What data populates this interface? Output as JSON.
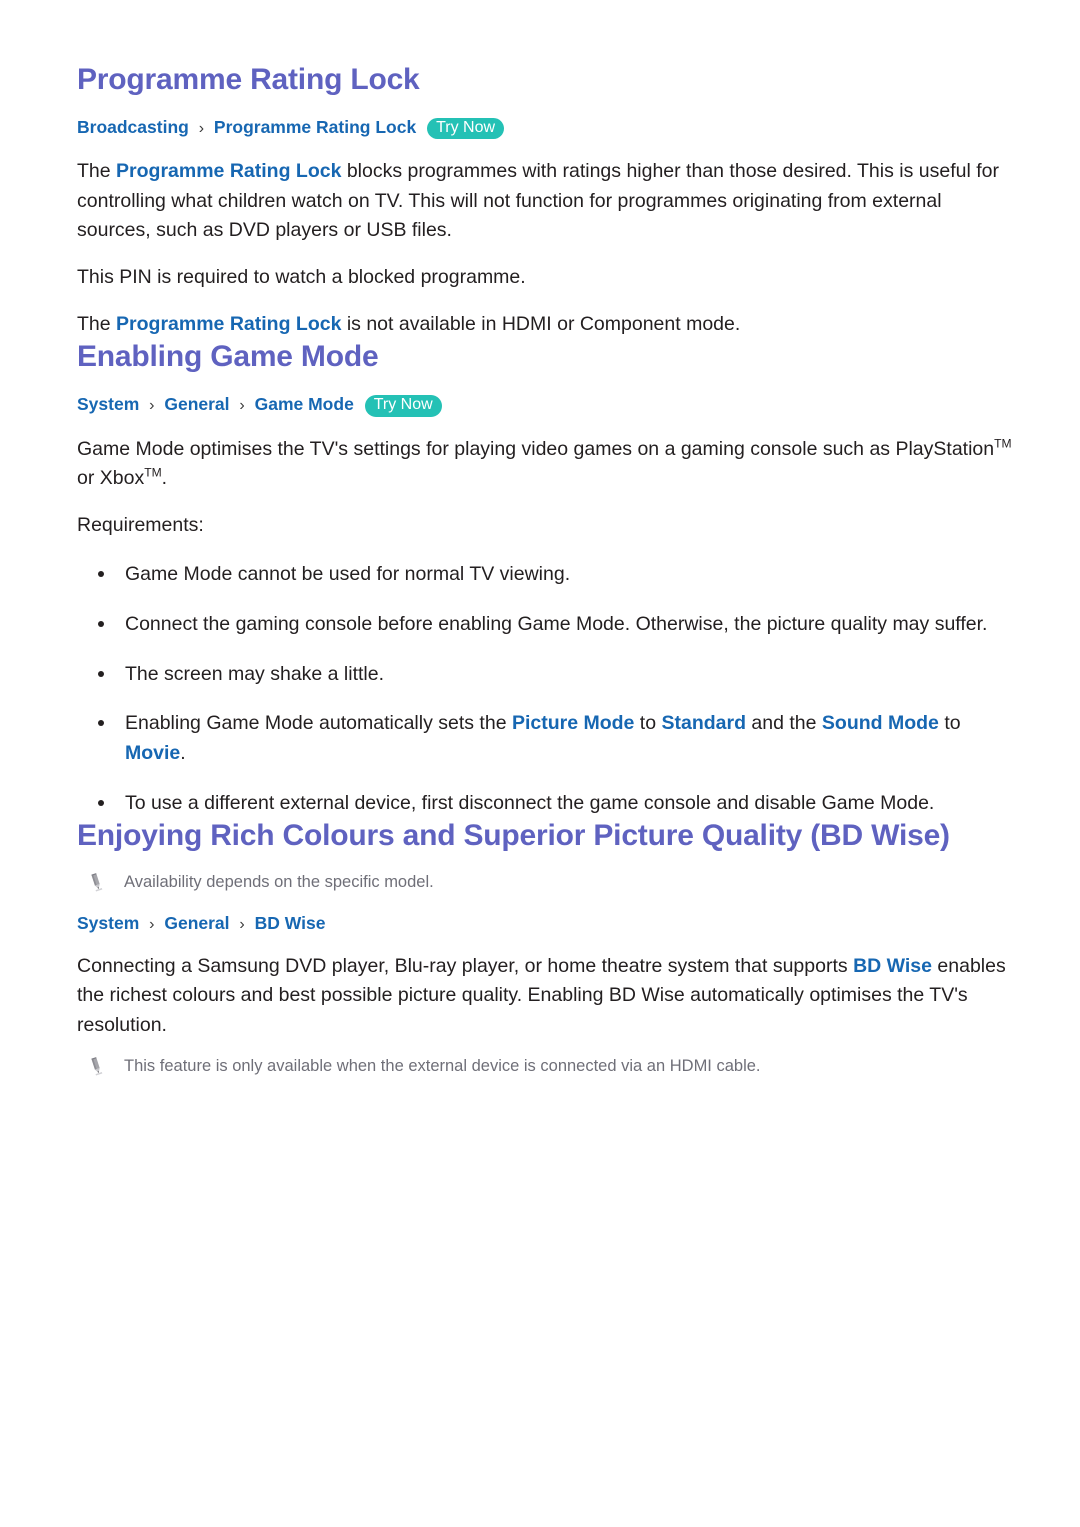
{
  "page": {
    "sections": [
      {
        "id": "programme-rating-lock",
        "title": "Programme Rating Lock",
        "breadcrumb": {
          "crumbs": [
            "Broadcasting",
            "Programme Rating Lock"
          ],
          "separator": "›",
          "badge": "Try Now"
        },
        "paragraphs": [
          {
            "id": "prl-p1",
            "runs": [
              {
                "t": "The ",
                "style": "plain"
              },
              {
                "t": "Programme Rating Lock",
                "style": "link"
              },
              {
                "t": " blocks programmes with ratings higher than those desired. This is useful for controlling what children watch on TV. This will not function for programmes originating from external sources, such as DVD players or USB files.",
                "style": "plain"
              }
            ]
          },
          {
            "id": "prl-p2",
            "runs": [
              {
                "t": "This PIN is required to watch a blocked programme.",
                "style": "plain"
              }
            ]
          },
          {
            "id": "prl-p3",
            "runs": [
              {
                "t": "The ",
                "style": "plain"
              },
              {
                "t": "Programme Rating Lock",
                "style": "link"
              },
              {
                "t": " is not available in HDMI or Component mode.",
                "style": "plain"
              }
            ]
          }
        ]
      },
      {
        "id": "enabling-game-mode",
        "title": "Enabling Game Mode",
        "breadcrumb": {
          "crumbs": [
            "System",
            "General",
            "Game Mode"
          ],
          "separator": "›",
          "badge": "Try Now"
        },
        "paragraphs": [
          {
            "id": "gm-p1",
            "runs": [
              {
                "t": "Game Mode optimises the TV's settings for playing video games on a gaming console such as PlayStation",
                "style": "plain"
              },
              {
                "t": "TM",
                "style": "sup"
              },
              {
                "t": " or Xbox",
                "style": "plain"
              },
              {
                "t": "TM",
                "style": "sup"
              },
              {
                "t": ".",
                "style": "plain"
              }
            ]
          },
          {
            "id": "gm-p2",
            "runs": [
              {
                "t": "Requirements:",
                "style": "plain"
              }
            ]
          }
        ],
        "requirements": [
          {
            "id": "req-1",
            "runs": [
              {
                "t": "Game Mode cannot be used for normal TV viewing.",
                "style": "plain"
              }
            ]
          },
          {
            "id": "req-2",
            "runs": [
              {
                "t": "Connect the gaming console before enabling Game Mode. Otherwise, the picture quality may suffer.",
                "style": "plain"
              }
            ]
          },
          {
            "id": "req-3",
            "runs": [
              {
                "t": "The screen may shake a little.",
                "style": "plain"
              }
            ]
          },
          {
            "id": "req-4",
            "runs": [
              {
                "t": "Enabling Game Mode automatically sets the ",
                "style": "plain"
              },
              {
                "t": "Picture Mode",
                "style": "link"
              },
              {
                "t": " to ",
                "style": "plain"
              },
              {
                "t": "Standard",
                "style": "link"
              },
              {
                "t": " and the ",
                "style": "plain"
              },
              {
                "t": "Sound Mode",
                "style": "link"
              },
              {
                "t": " to ",
                "style": "plain"
              },
              {
                "t": "Movie",
                "style": "link"
              },
              {
                "t": ".",
                "style": "plain"
              }
            ]
          },
          {
            "id": "req-5",
            "runs": [
              {
                "t": "To use a different external device, first disconnect the game console and disable Game Mode.",
                "style": "plain"
              }
            ]
          }
        ]
      },
      {
        "id": "bd-wise",
        "title": "Enjoying Rich Colours and Superior Picture Quality (BD Wise)",
        "note_top": {
          "id": "bd-note-top",
          "icon": "pencil-icon",
          "text": "Availability depends on the specific model."
        },
        "breadcrumb": {
          "crumbs": [
            "System",
            "General",
            "BD Wise"
          ],
          "separator": "›",
          "badge": ""
        },
        "paragraphs": [
          {
            "id": "bd-p1",
            "runs": [
              {
                "t": "Connecting a Samsung DVD player, Blu-ray player, or home theatre system that supports ",
                "style": "plain"
              },
              {
                "t": "BD Wise",
                "style": "link"
              },
              {
                "t": " enables the richest colours and best possible picture quality. Enabling BD Wise automatically optimises the TV's resolution.",
                "style": "plain"
              }
            ]
          }
        ],
        "note_bottom": {
          "id": "bd-note-bottom",
          "icon": "pencil-icon",
          "text": "This feature is only available when the external device is connected via an HDMI cable."
        }
      }
    ]
  },
  "colors": {
    "heading": "#5f62c0",
    "link": "#1767b2",
    "badge_bg": "#24c1b5",
    "badge_text": "#ffffff",
    "body_text": "#231f20",
    "note_text": "#6f6f78",
    "page_bg": "#ffffff"
  }
}
